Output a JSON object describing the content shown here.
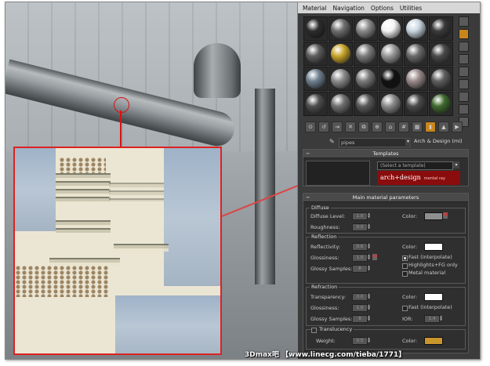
{
  "menu": [
    "Material",
    "Navigation",
    "Options",
    "Utilities"
  ],
  "material_name": "pipes",
  "material_type": "Arch & Design (mi)",
  "templates": {
    "title": "Templates",
    "select_placeholder": "(Select a template)",
    "banner_text": "arch+design",
    "banner_sub": "mental ray"
  },
  "main_params": {
    "title": "Main material parameters",
    "diffuse": {
      "title": "Diffuse",
      "level_label": "Diffuse Level:",
      "level_value": "1.0",
      "roughness_label": "Roughness:",
      "roughness_value": "0.0",
      "color_label": "Color:",
      "color": "#8f8f8f",
      "map_button": "M"
    },
    "reflection": {
      "title": "Reflection",
      "reflectivity_label": "Reflectivity:",
      "reflectivity_value": "0.6",
      "glossiness_label": "Glossiness:",
      "glossiness_value": "1.0",
      "glossy_samples_label": "Glossy Samples:",
      "glossy_samples_value": "8",
      "color_label": "Color:",
      "color": "#ffffff",
      "fast_label": "Fast (interpolate)",
      "highlights_label": "Highlights+FG only",
      "metal_label": "Metal material",
      "map_button": "M"
    },
    "refraction": {
      "title": "Refraction",
      "transparency_label": "Transparency:",
      "transparency_value": "0.0",
      "glossiness_label": "Glossiness:",
      "glossiness_value": "1.0",
      "glossy_samples_label": "Glossy Samples:",
      "glossy_samples_value": "8",
      "color_label": "Color:",
      "color": "#ffffff",
      "fast_label": "Fast (interpolate)",
      "ior_label": "IOR:",
      "ior_value": "1.4"
    },
    "translucency": {
      "label": "Translucency",
      "weight_label": "Weight:",
      "weight_value": "0.5",
      "color_label": "Color:",
      "color": "#c8962a"
    }
  },
  "spheres": [
    "#2c2c2c",
    "#6e6e6e",
    "#8a8a8a",
    "#f4f4f4",
    "#c9d6e0",
    "#3a3a3a",
    "#5d5d5d",
    "#c8a52a",
    "#7d7d7d",
    "#9a9a9a",
    "#6a6a6a",
    "#4a4a4a",
    "#708090",
    "#8b8b8b",
    "#7a7a7a",
    "#111111",
    "#9a8a8a",
    "#5f5f5f",
    "#4f4f4f",
    "#707070",
    "#5a5a5a",
    "#8a8a8a",
    "#4b4b4b",
    "#3f6a2e"
  ],
  "footer_text": "3Dmax吧 【www.linecg.com/tieba/1771】"
}
